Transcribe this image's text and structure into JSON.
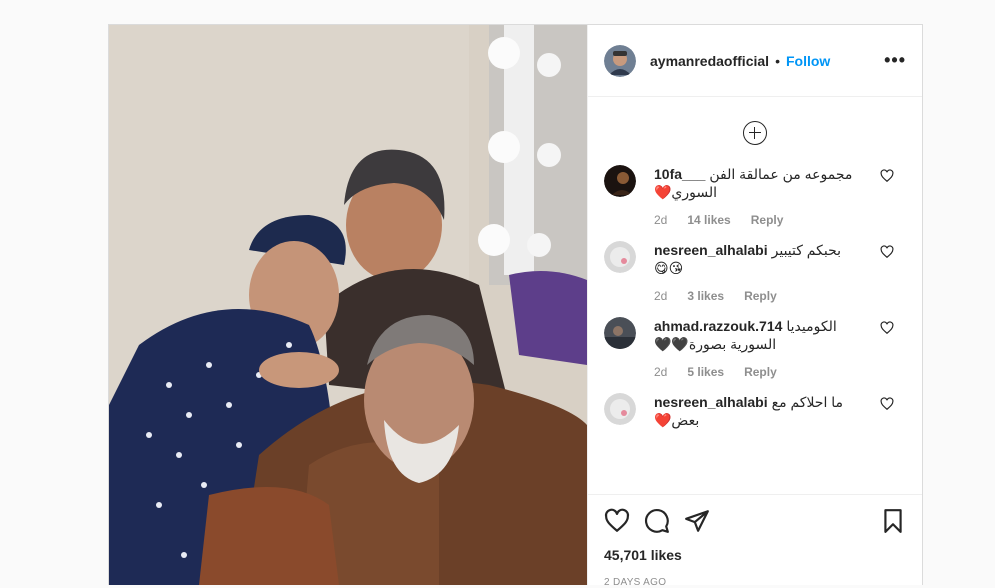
{
  "post": {
    "username": "aymanredaofficial",
    "separator": "•",
    "follow_label": "Follow",
    "more_label": "•••",
    "likes": "45,701 likes",
    "posted": "2 DAYS AGO"
  },
  "comments": [
    {
      "username": "10fa___",
      "text": "مجموعه من عمالقة الفن السوري❤️",
      "age": "2d",
      "likes": "14 likes",
      "reply": "Reply"
    },
    {
      "username": "nesreen_alhalabi",
      "text": "بحبكم كتيبير 😘😋",
      "age": "2d",
      "likes": "3 likes",
      "reply": "Reply"
    },
    {
      "username": "ahmad.razzouk.714",
      "text": "الكوميديا السورية بصورة🖤🖤",
      "age": "2d",
      "likes": "5 likes",
      "reply": "Reply"
    },
    {
      "username": "nesreen_alhalabi",
      "text": "ما احلاكم مع بعض❤️",
      "age": "",
      "likes": "",
      "reply": ""
    }
  ],
  "icons": {
    "like": "heart-icon",
    "comment": "comment-icon",
    "share": "paper-plane-icon",
    "save": "bookmark-icon",
    "load_more": "plus-circle-icon",
    "comment_like": "heart-icon"
  },
  "colors": {
    "link": "#0095f6",
    "text": "#262626",
    "muted": "#8e8e8e",
    "border": "#dbdbdb"
  }
}
